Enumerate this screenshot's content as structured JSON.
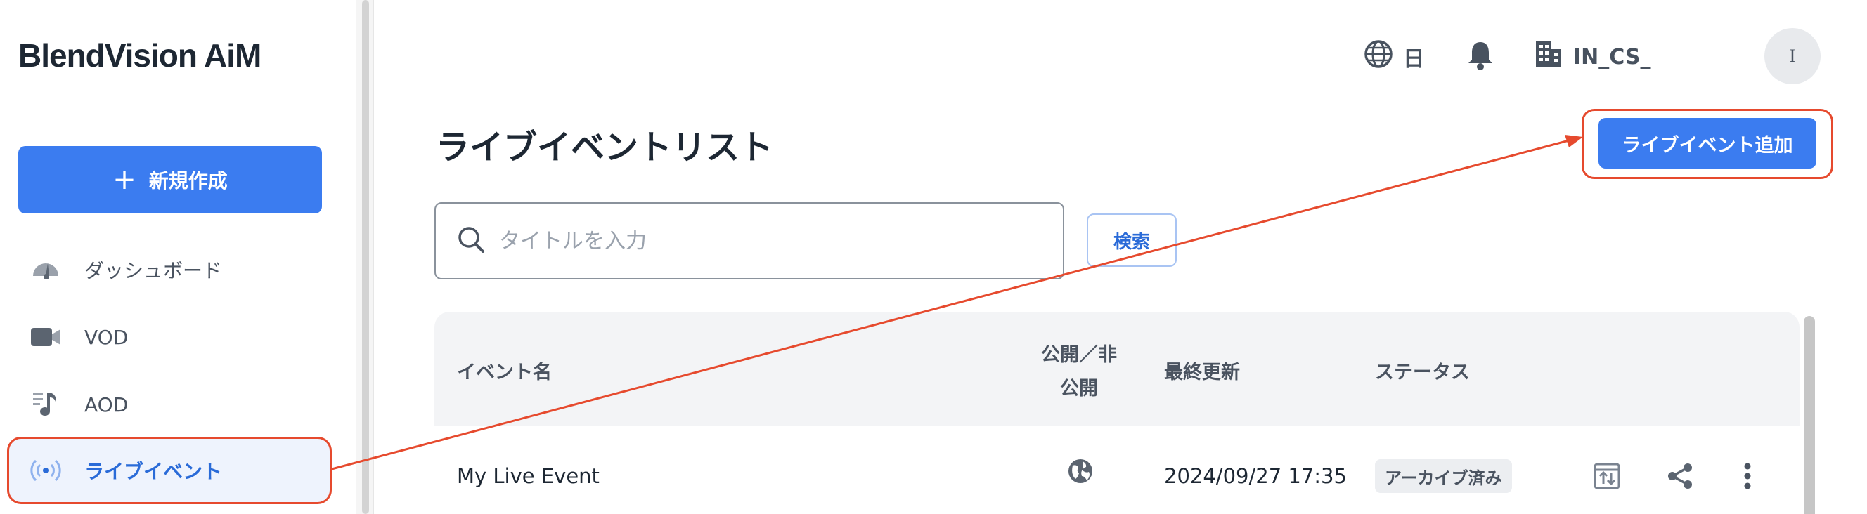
{
  "brand": {
    "logo_text": "BlendVision AiM",
    "accent": "#3b7cf0",
    "highlight": "#e64a2e"
  },
  "sidebar": {
    "create_button": {
      "plus": "+",
      "label": "新規作成"
    },
    "items": [
      {
        "label": "ダッシュボード",
        "icon": "dashboard-gauge-icon",
        "active": false
      },
      {
        "label": "VOD",
        "icon": "video-camera-icon",
        "active": false
      },
      {
        "label": "AOD",
        "icon": "audio-note-icon",
        "active": false
      },
      {
        "label": "ライブイベント",
        "icon": "live-broadcast-icon",
        "active": true
      }
    ]
  },
  "header": {
    "language": {
      "icon": "globe-icon",
      "label": "日"
    },
    "notifications": {
      "icon": "bell-icon"
    },
    "org": {
      "icon": "building-icon",
      "label": "IN_CS_"
    },
    "avatar": {
      "initial": "I"
    }
  },
  "main": {
    "title": "ライブイベントリスト",
    "add_button": "ライブイベント追加",
    "search": {
      "placeholder": "タイトルを入力",
      "value": "",
      "button": "検索"
    },
    "table": {
      "columns": [
        "イベント名",
        "公開／非\n公開",
        "最終更新",
        "ステータス"
      ],
      "rows": [
        {
          "name": "My Live Event",
          "visibility_icon": "globe-public-icon",
          "updated": "2024/09/27 17:35",
          "status": "アーカイブ済み",
          "actions": [
            "console-icon",
            "share-icon",
            "more-vertical-icon"
          ]
        }
      ]
    }
  }
}
